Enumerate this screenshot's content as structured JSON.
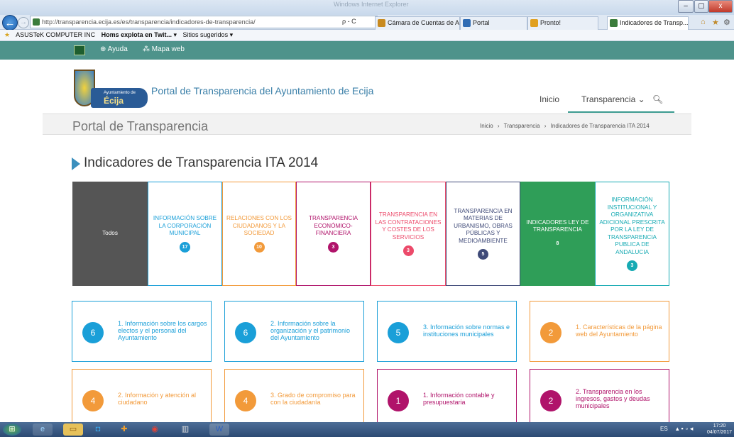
{
  "browser": {
    "window_title": "Windows Internet Explorer",
    "address": "http://transparencia.ecija.es/es/transparencia/indicadores-de-transparencia/",
    "addr_controls": "ρ - C",
    "tabs": [
      {
        "label": "Cámara de Cuentas de A...",
        "color": "#c88a1f"
      },
      {
        "label": "Portal",
        "color": "#2f6bb3"
      },
      {
        "label": "Pronto!",
        "color": "#e0a020"
      },
      {
        "label": "Indicadores de Transp...",
        "color": "#3b7c3b"
      }
    ],
    "favorites": [
      "ASUSTeK COMPUTER INC",
      "Homs explota en Twit... ▾",
      "Sitios sugeridos ▾"
    ],
    "window_buttons": [
      "–",
      "▢",
      "x"
    ],
    "toolbar_icons": [
      "home-icon",
      "star-icon",
      "gear-icon"
    ]
  },
  "topbar": {
    "help": "Ayuda",
    "sitemap": "Mapa web"
  },
  "header": {
    "logo_small": "Ayuntamiento de",
    "logo_big": "Écija",
    "site_title": "Portal de Transparencia del Ayuntamiento de Ecija",
    "menu": {
      "inicio": "Inicio",
      "transparencia": "Transparencia ⌄"
    }
  },
  "breadcrumb_bar": {
    "heading": "Portal de Transparencia",
    "items": [
      "Inicio",
      "›",
      "Transparencia",
      "›",
      "Indicadores de Transparencia ITA 2014"
    ]
  },
  "section": {
    "title": "Indicadores de Transparencia ITA 2014"
  },
  "categories": [
    {
      "label": "Todos",
      "count": "",
      "color": "#555555"
    },
    {
      "label": "INFORMACIÓN SOBRE LA CORPORACIÓN MUNICIPAL",
      "count": "17",
      "color": "#1a9fd8"
    },
    {
      "label": "RELACIONES CON LOS CIUDADANOS Y LA SOCIEDAD",
      "count": "10",
      "color": "#f29a3a"
    },
    {
      "label": "TRANSPARENCIA ECONÓMICO-FINANCIERA",
      "count": "3",
      "color": "#b0136a"
    },
    {
      "label": "TRANSPARENCIA EN LAS CONTRATACIONES Y COSTES DE LOS SERVICIOS",
      "count": "3",
      "color": "#ec4a6a"
    },
    {
      "label": "TRANSPARENCIA EN MATERIAS DE URBANISMO, OBRAS PÚBLICAS Y MEDIOAMBIENTE",
      "count": "5",
      "color": "#3f4a78"
    },
    {
      "label": "INDICADORES LEY DE TRANSPARENCIA",
      "count": "8",
      "color": "#2f9e58"
    },
    {
      "label": "INFORMACIÓN INSTITUCIONAL Y ORGANIZATIVA ADICIONAL PRESCRITA POR LA LEY DE TRANSPARENCIA PUBLICA DE ANDALUCIA",
      "count": "3",
      "color": "#16aab3"
    }
  ],
  "cards": [
    {
      "num": "6",
      "text": "1. Información sobre los cargos electos y el personal del Ayuntamiento",
      "color": "#1a9fd8"
    },
    {
      "num": "6",
      "text": "2. Información sobre la organización y el patrimonio del Ayuntamiento",
      "color": "#1a9fd8"
    },
    {
      "num": "5",
      "text": "3. Información sobre normas e instituciones municipales",
      "color": "#1a9fd8"
    },
    {
      "num": "2",
      "text": "1. Características de la página web del Ayuntamiento",
      "color": "#f29a3a"
    },
    {
      "num": "4",
      "text": "2. Información y atención al ciudadano",
      "color": "#f29a3a"
    },
    {
      "num": "4",
      "text": "3. Grado de compromiso para con la ciudadanía",
      "color": "#f29a3a"
    },
    {
      "num": "1",
      "text": "1. Información contable y presupuestaria",
      "color": "#b0136a"
    },
    {
      "num": "2",
      "text": "2. Transparencia en los ingresos, gastos y deudas municipales",
      "color": "#b0136a"
    }
  ],
  "taskbar": {
    "lang": "ES",
    "time": "17:20",
    "date": "04/07/2017"
  }
}
